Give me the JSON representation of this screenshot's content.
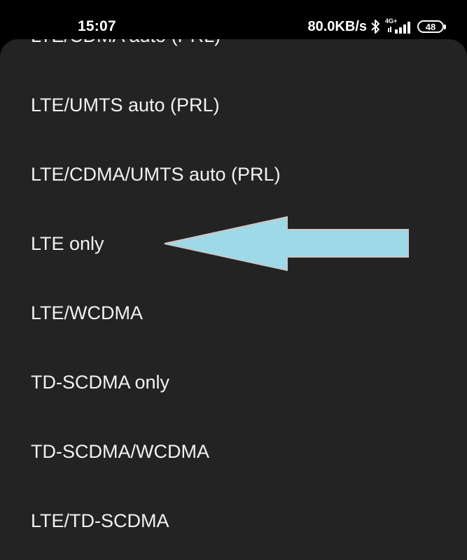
{
  "status_bar": {
    "time": "15:07",
    "net_speed": "80.0KB/s",
    "net_type": "4G+",
    "battery": "48",
    "icons": [
      "bluetooth-icon",
      "signal-icon",
      "battery-icon"
    ]
  },
  "network_modes": {
    "options": [
      "LTE/CDMA auto (PRL)",
      "LTE/UMTS auto (PRL)",
      "LTE/CDMA/UMTS auto (PRL)",
      "LTE only",
      "LTE/WCDMA",
      "TD-SCDMA only",
      "TD-SCDMA/WCDMA",
      "LTE/TD-SCDMA"
    ]
  },
  "annotation": {
    "arrow_color": "#9ED9E8",
    "arrow_outline": "#C8C8C8",
    "points_to": "LTE only"
  },
  "colors": {
    "background": "#000000",
    "sheet": "#232323",
    "text": "#F2F2F2"
  }
}
